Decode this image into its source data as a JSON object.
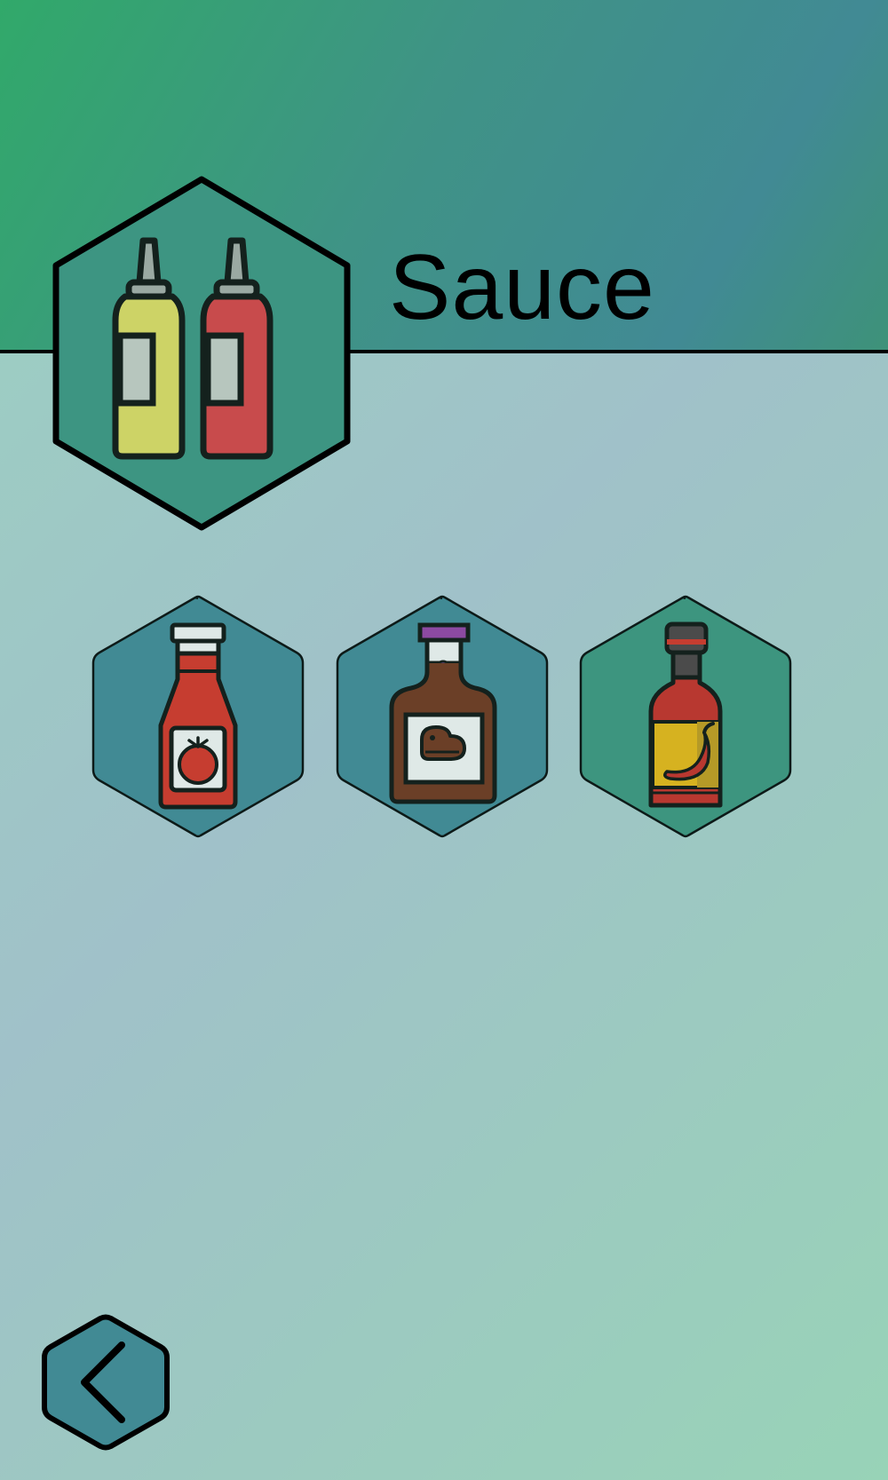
{
  "header": {
    "title": "Sauce",
    "category_icon": "condiment-squeeze-bottles-icon"
  },
  "items": [
    {
      "icon": "ketchup-bottle-icon",
      "fill": "#418a94"
    },
    {
      "icon": "bbq-sauce-bottle-icon",
      "fill": "#418a94"
    },
    {
      "icon": "hot-sauce-bottle-icon",
      "fill": "#3d957f"
    }
  ],
  "navigation": {
    "back_icon": "chevron-left-icon"
  },
  "colors": {
    "header_start": "#31a96a",
    "header_end": "#418a94",
    "tile_teal": "#418a94",
    "tile_green": "#3d957f"
  }
}
